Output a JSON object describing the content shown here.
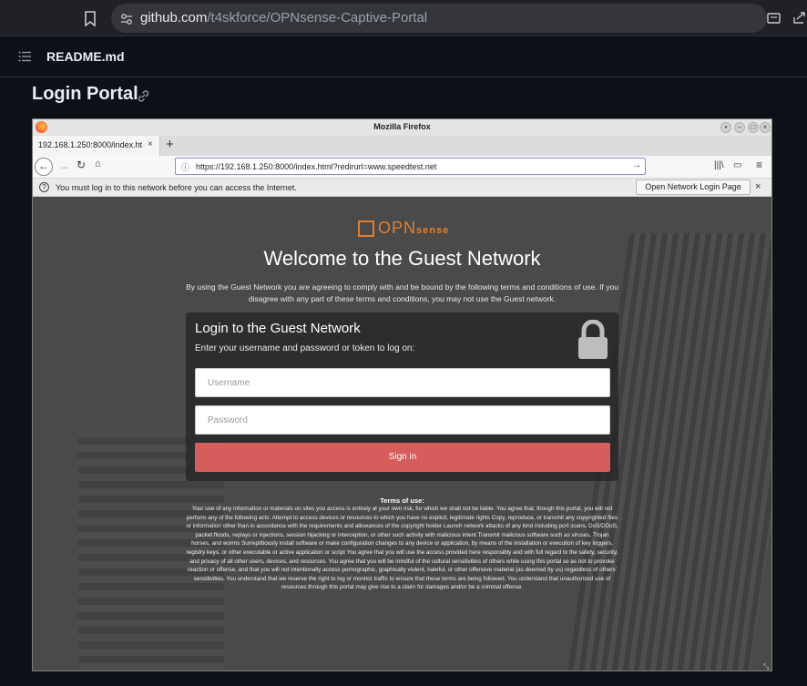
{
  "browser": {
    "url_host": "github.com",
    "url_path": "/t4skforce/OPNsense-Captive-Portal"
  },
  "readme": {
    "file_name": "README.md",
    "heading": "Login Portal"
  },
  "firefox": {
    "window_title": "Mozilla Firefox",
    "tab_label": "192.168.1.250:8000/index.ht",
    "tab_close": "×",
    "new_tab": "+",
    "url": "https://192.168.1.250:8000/index.html?redirurl=www.speedtest.net",
    "notice_text": "You must log in to this network before you can access the Internet.",
    "notice_button": "Open Network Login Page",
    "notice_close": "×"
  },
  "portal": {
    "logo_opn": "OPN",
    "logo_sense": "sense",
    "welcome": "Welcome to the Guest Network",
    "agreement": "By using the Guest Network you are agreeing to comply with and be bound by the following terms and conditions of use. If you disagree with any part of these terms and conditions, you may not use the Guest network.",
    "card_title": "Login to the Guest Network",
    "card_subtitle": "Enter your username and password or token to log on:",
    "username_placeholder": "Username",
    "password_placeholder": "Password",
    "signin_label": "Sign in",
    "terms_title": "Terms of use:",
    "terms_body": "Your use of any information or materials on sites you access is entirely at your own risk, for which we shall not be liable. You agree that, though this portal, you will not perform any of the following acts: Attempt to access devices or resources to which you have no explicit, legitimate rights Copy, reproduce, or transmit any copyrighted files or information other than in accordance with the requirements and allowances of the copyright holder Launch network attacks of any kind including port scans, DoS/DDoS, packet floods, replays or injections, session hijacking or interception, or other such activity with malicious intent Transmit malicious software such as viruses, Trojan horses, and worms Surreptitiously install software or make configuration changes to any device or application, by means of the installation or execution of key loggers, registry keys, or other executable or active application or script You agree that you will use the access provided here responsibly and with full regard to the safety, security, and privacy of all other users, devices, and resources. You agree that you will be mindful of the cultural sensitivities of others while using this portal so as not to provoke reaction or offense, and that you will not intentionally access pornographic, graphically violent, hateful, or other offensive material (as deemed by us) regardless of others' sensitivities. You understand that we reserve the right to log or monitor traffic to ensure that these terms are being followed. You understand that unauthorized use of resources through this portal may give rise to a claim for damages and/or be a criminal offense."
  },
  "colors": {
    "accent_opnsense": "#e0802f",
    "signin_button": "#d75c5c",
    "github_bg": "#0d1117"
  }
}
